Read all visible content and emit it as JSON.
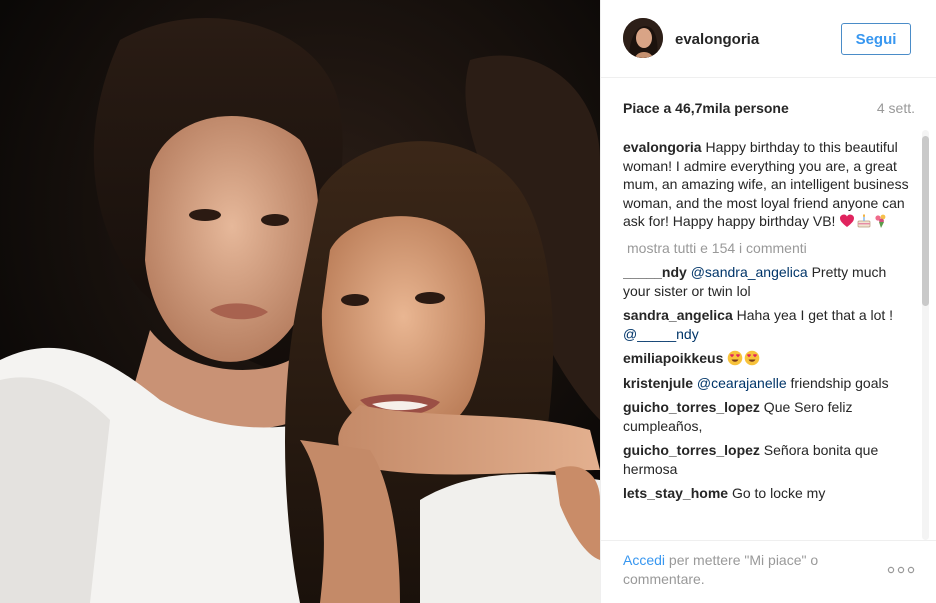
{
  "post": {
    "author": "evalongoria",
    "follow_label": "Segui",
    "likes_text": "Piace a 46,7mila persone",
    "time_ago": "4 sett.",
    "caption_user": "evalongoria",
    "caption_text": "Happy birthday to this beautiful woman! I admire everything you are, a great mum, an amazing wife, an intelligent business woman, and the most loyal friend anyone can ask for! Happy happy birthday VB!",
    "caption_emojis": [
      "heart-emoji",
      "cake-emoji",
      "bouquet-emoji"
    ],
    "show_all_comments": "mostra tutti e 154 i commenti"
  },
  "comments": [
    {
      "user": "_____ndy",
      "mention": "@sandra_angelica",
      "text": " Pretty much your sister or twin lol"
    },
    {
      "user": "sandra_angelica",
      "text": " Haha yea I get that a lot ! ",
      "mention_after": "@_____ndy"
    },
    {
      "user": "emiliapoikkeus",
      "text": " ",
      "emojis": [
        "heart-eyes-emoji",
        "heart-eyes-emoji"
      ]
    },
    {
      "user": "kristenjule",
      "mention": "@cearajanelle",
      "text": " friendship goals"
    },
    {
      "user": "guicho_torres_lopez",
      "text": " Que Sero feliz cumpleaños,"
    },
    {
      "user": "guicho_torres_lopez",
      "text": " Señora bonita que hermosa"
    },
    {
      "user": "lets_stay_home",
      "text": " Go to locke my"
    }
  ],
  "footer": {
    "login_link": "Accedi",
    "login_rest": " per mettere \"Mi piace\" o commentare.",
    "more_icon": "more-options-icon"
  },
  "colors": {
    "link_blue": "#3897f0",
    "mention_blue": "#003569",
    "muted_gray": "#999999",
    "text_dark": "#262626"
  }
}
